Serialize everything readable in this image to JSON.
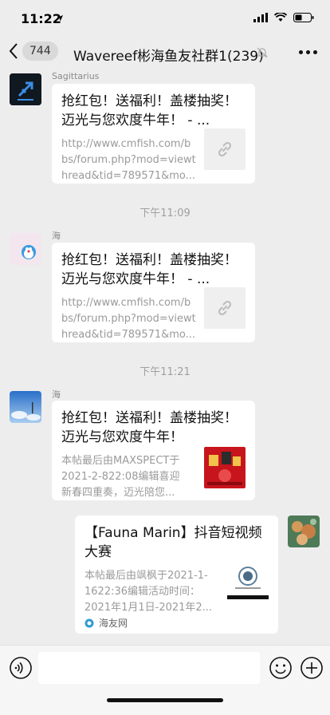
{
  "status": {
    "time": "11:22"
  },
  "header": {
    "unread_count": "744",
    "title": "Wavereef彬海鱼友社群1(239)"
  },
  "messages": [
    {
      "sender": "Sagittarius",
      "title_line1": "抢红包！送福利！盖楼抽奖！",
      "title_line2": "迈光与您欢度牛年！ - ...",
      "desc_line1": "http://www.cmfish.com/b",
      "desc_line2": "bs/forum.php?mod=viewt",
      "desc_line3": "hread&tid=789571&mo..."
    },
    {
      "time": "下午11:09",
      "sender": "海",
      "title_line1": "抢红包！送福利！盖楼抽奖！",
      "title_line2": "迈光与您欢度牛年！ - ...",
      "desc_line1": "http://www.cmfish.com/b",
      "desc_line2": "bs/forum.php?mod=viewt",
      "desc_line3": "hread&tid=789571&mo..."
    },
    {
      "time": "下午11:21",
      "sender": "海",
      "title_line1": "抢红包！送福利！盖楼抽奖！",
      "title_line2": "迈光与您欢度牛年！",
      "desc_line1": "本帖最后由MAXSPECT于",
      "desc_line2": "2021-2-822:08编辑喜迎",
      "desc_line3": "新春四重奏，迈光陪您..."
    },
    {
      "title_line1": "【Fauna Marin】抖音短视频",
      "title_line2": "大赛",
      "desc_line1": "本帖最后由飒枫于2021-1-",
      "desc_line2": "1622:36编辑活动时间：",
      "desc_line3": "2021年1月1日-2021年2...",
      "source": "海友网"
    }
  ],
  "colors": {
    "background": "#ededed",
    "card": "#ffffff",
    "muted_text": "#9a9a9a"
  }
}
